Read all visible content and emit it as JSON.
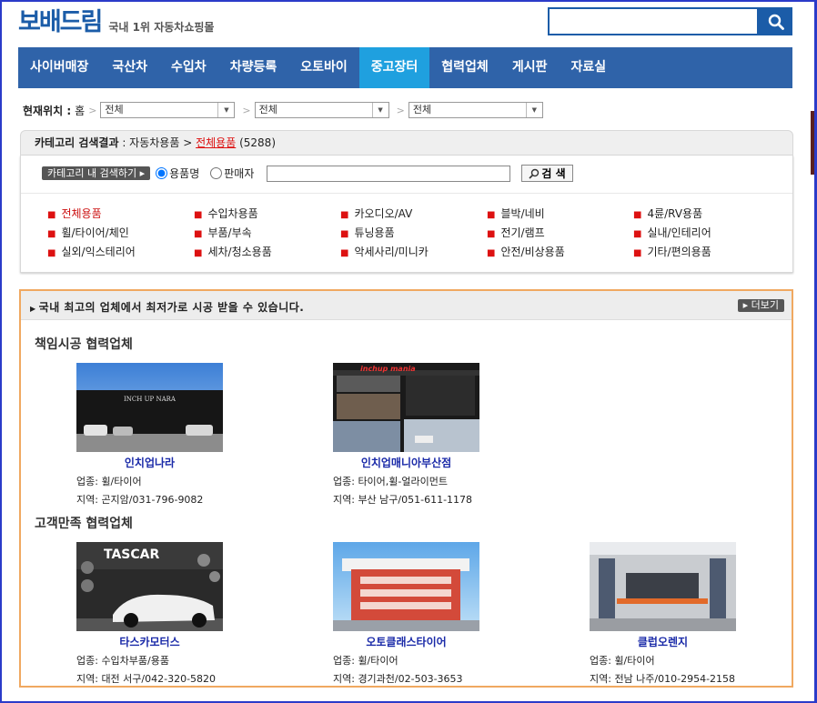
{
  "header": {
    "logo": "보배드림",
    "tagline": "국내 1위 자동차쇼핑몰",
    "search_placeholder": ""
  },
  "nav": [
    "사이버매장",
    "국산차",
    "수입차",
    "차량등록",
    "오토바이",
    "중고장터",
    "협력업체",
    "게시판",
    "자료실"
  ],
  "nav_active": "중고장터",
  "location": {
    "label": "현재위치 :",
    "home": "홈",
    "selects": [
      "전체",
      "전체",
      "전체"
    ]
  },
  "category": {
    "head_label": "카테고리 검색결과",
    "path": ": 자동차용품 >",
    "current": "전체용품",
    "count": "(5288)",
    "in_search_label": "카테고리 내 검색하기",
    "radio_product": "용품명",
    "radio_seller": "판매자",
    "search_button": "검 색",
    "items": [
      "전체용품",
      "수입차용품",
      "카오디오/AV",
      "블박/네비",
      "4륜/RV용품",
      "휠/타이어/체인",
      "부품/부속",
      "튜닝용품",
      "전기/램프",
      "실내/인테리어",
      "실외/익스테리어",
      "세차/청소용품",
      "악세사리/미니카",
      "안전/비상용품",
      "기타/편의용품"
    ]
  },
  "partners": {
    "title": "국내 최고의 업체에서 최저가로 시공 받을 수 있습니다.",
    "more": "더보기",
    "section1": "책임시공 협력업체",
    "section2": "고객만족 협력업체",
    "cards": [
      {
        "name": "인치업나라",
        "type": "업종: 휠/타이어",
        "area": "지역: 곤지암/031-796-9082",
        "sign": "INCH UP NARA"
      },
      {
        "name": "인치업매니아부산점",
        "type": "업종: 타이어,휠-얼라이먼트",
        "area": "지역: 부산 남구/051-611-1178",
        "sign": "inchup mania"
      },
      {
        "name": "타스카모터스",
        "type": "업종: 수입차부품/용품",
        "area": "지역: 대전 서구/042-320-5820",
        "sign": "TASCAR"
      },
      {
        "name": "오토클래스타이어",
        "type": "업종: 휠/타이어",
        "area": "지역: 경기과천/02-503-3653"
      },
      {
        "name": "클럽오렌지",
        "type": "업종: 휠/타이어",
        "area": "지역: 전남 나주/010-2954-2158"
      }
    ]
  },
  "colors": {
    "brand": "#1b5ca8",
    "nav": "#2f63a9",
    "nav_active": "#1fa0df",
    "accent_red": "#d11111",
    "partner_border": "#f0a860"
  }
}
